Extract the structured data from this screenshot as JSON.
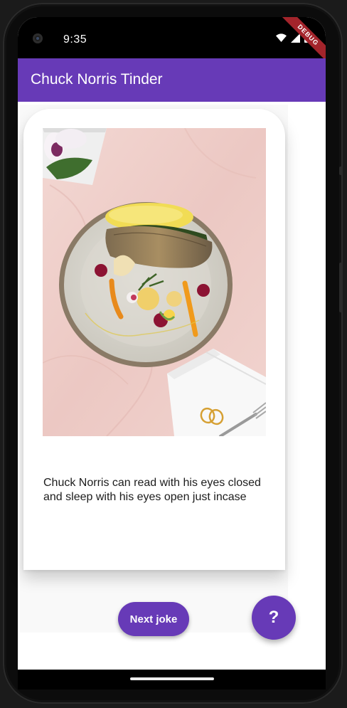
{
  "status_bar": {
    "time": "9:35",
    "icons": [
      "wifi-icon",
      "cellular-icon",
      "battery-icon"
    ],
    "debug_label": "DEBUG"
  },
  "app_bar": {
    "title": "Chuck Norris Tinder",
    "color": "#673ab7"
  },
  "card": {
    "image_alt": "",
    "joke": "Chuck Norris can read with his eyes closed and sleep with his eyes open just incase"
  },
  "actions": {
    "next_label": "Next joke",
    "fab_label": "?"
  },
  "colors": {
    "accent": "#673ab7",
    "background": "#f9f9f9"
  }
}
